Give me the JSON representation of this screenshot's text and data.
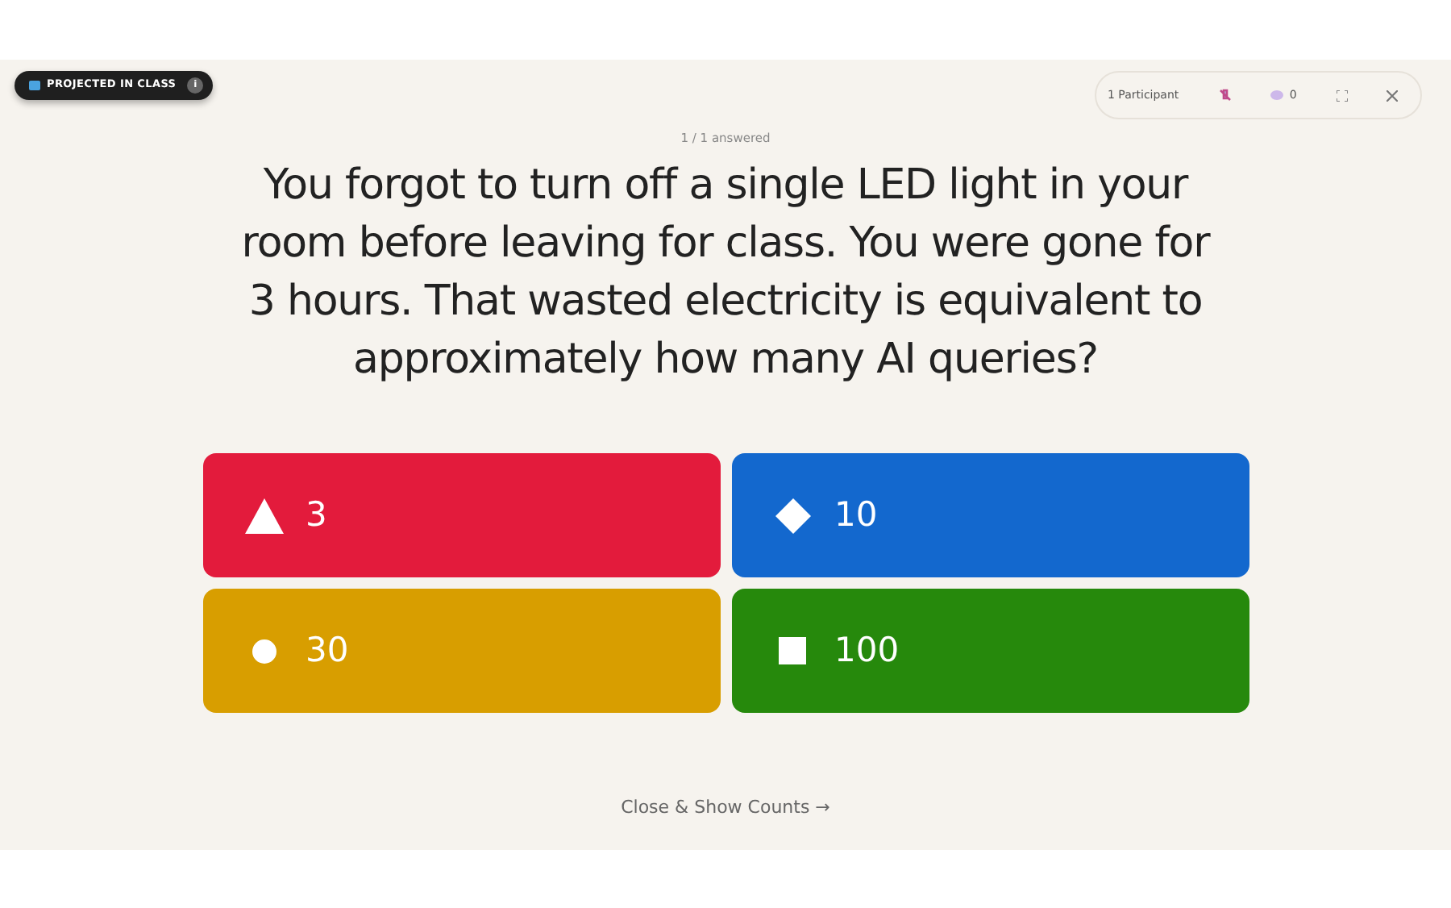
{
  "badge": {
    "label": "PROJECTED IN CLASS",
    "info": "i"
  },
  "toolbar": {
    "participants": "1 Participant",
    "comments": "0"
  },
  "progress": "1 / 1 answered",
  "question": "You forgot to turn off a single LED light in your room before leaving for class. You were gone for 3 hours. That wasted electricity is equivalent to approximately how many AI queries?",
  "answers": [
    {
      "label": "3",
      "kind": "triangle",
      "color": "#e31b3c"
    },
    {
      "label": "10",
      "kind": "diamond",
      "color": "#1368ce"
    },
    {
      "label": "30",
      "kind": "circle",
      "color": "#d89e00"
    },
    {
      "label": "100",
      "kind": "square",
      "color": "#26890c"
    }
  ],
  "footer_link": "Close & Show Counts →"
}
